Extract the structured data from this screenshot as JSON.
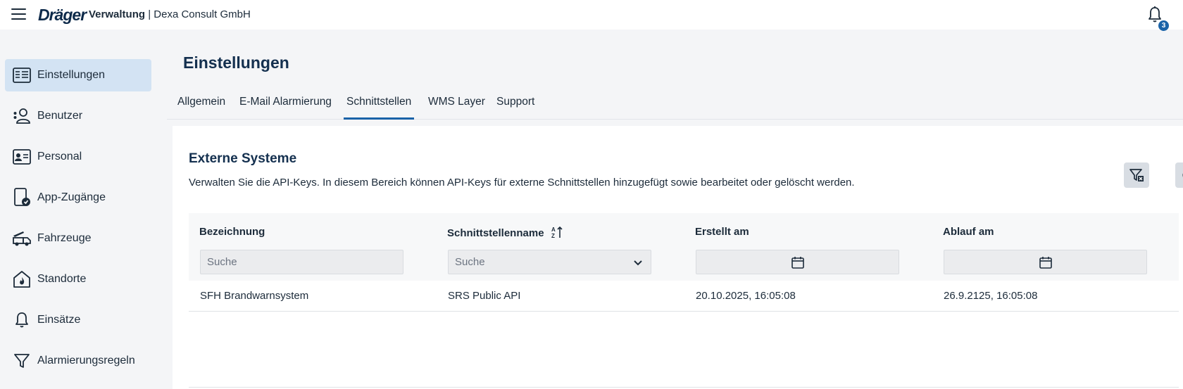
{
  "header": {
    "logo": "Dräger",
    "app_name": "Verwaltung",
    "separator": " | ",
    "org_name": "Dexa Consult GmbH",
    "notification_count": "3"
  },
  "sidebar": {
    "items": [
      {
        "label": "Einstellungen",
        "icon": "settings-panel-icon",
        "active": true
      },
      {
        "label": "Benutzer",
        "icon": "user-icon"
      },
      {
        "label": "Personal",
        "icon": "id-card-icon"
      },
      {
        "label": "App-Zugänge",
        "icon": "app-access-icon"
      },
      {
        "label": "Fahrzeuge",
        "icon": "fire-truck-icon"
      },
      {
        "label": "Standorte",
        "icon": "station-icon"
      },
      {
        "label": "Einsätze",
        "icon": "bell-icon"
      },
      {
        "label": "Alarmierungsregeln",
        "icon": "filter-icon"
      }
    ]
  },
  "page": {
    "title": "Einstellungen",
    "tabs": [
      {
        "label": "Allgemein"
      },
      {
        "label": "E-Mail Alarmierung"
      },
      {
        "label": "Schnittstellen",
        "active": true
      },
      {
        "label": "WMS Layer"
      },
      {
        "label": "Support"
      }
    ]
  },
  "section": {
    "title": "Externe Systeme",
    "description": "Verwalten Sie die API-Keys. In diesem Bereich können API-Keys für externe Schnittstellen hinzugefügt sowie bearbeitet oder gelöscht werden."
  },
  "table": {
    "columns": [
      {
        "label": "Bezeichnung",
        "filter_placeholder": "Suche"
      },
      {
        "label": "Schnittstellenname",
        "filter_placeholder": "Suche",
        "sorted": "ascending"
      },
      {
        "label": "Erstellt am"
      },
      {
        "label": "Ablauf am"
      }
    ],
    "rows": [
      {
        "bezeichnung": "SFH Brandwarnsystem",
        "schnittstelle": "SRS Public API",
        "erstellt": "20.10.2025, 16:05:08",
        "ablauf": "26.9.2125, 16:05:08"
      }
    ]
  },
  "colors": {
    "accent": "#1a63a8",
    "active_nav_bg": "#d3e3f3",
    "text": "#1c2b3a"
  }
}
